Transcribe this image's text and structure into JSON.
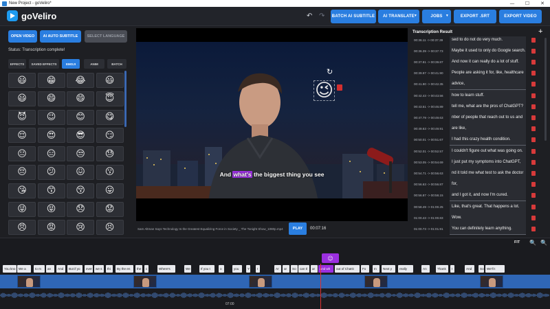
{
  "window": {
    "title": "New Project - goVeliro*",
    "minimize": "—",
    "maximize": "☐",
    "close": "✕"
  },
  "header": {
    "logo_text": "goVeliro",
    "undo_icon": "↶",
    "redo_icon": "↷",
    "buttons": {
      "batch_ai_subtitle": "BATCH AI SUBTITLE",
      "ai_translate": "AI TRANSLATE",
      "jobs": "JOBS",
      "export_srt": "EXPORT .SRT",
      "export_video": "EXPORT VIDEO"
    },
    "accent_color": "#2a7ee0"
  },
  "left_panel": {
    "open_video": "OPEN VIDEO",
    "ai_auto_subtitle": "AI AUTO SUBTITLE",
    "select_language": "SELECT LANGUAGE",
    "status": "Status: Transcription complete!",
    "tabs": [
      "EFFECTS",
      "SAVED EFFECTS",
      "EMOJI",
      "ANIM",
      "BATCH"
    ],
    "active_tab": "EMOJI",
    "emojis": [
      "😃",
      "😁",
      "😂",
      "😃",
      "😃",
      "😄",
      "😄",
      "😇",
      "😈",
      "😉",
      "😊",
      "😋",
      "😌",
      "😍",
      "😎",
      "😏",
      "😐",
      "😑",
      "😒",
      "😓",
      "😔",
      "😕",
      "😖",
      "😗",
      "😘",
      "😙",
      "😚",
      "😛",
      "😜",
      "😝",
      "😞",
      "😟",
      "😠",
      "😡",
      "😢",
      "😣"
    ]
  },
  "video": {
    "subtitle_before": "And ",
    "subtitle_highlight": "what's",
    "subtitle_after": " the biggest thing you see",
    "overlay_emoji": "😉",
    "rotate_icon": "↻",
    "file_name": "Sam Altman Says Technology Is the Greatest Equalizing Force in Society _ The Tonight Show_1080p.mp4",
    "play_label": "PLAY",
    "timecode": "00:07:16"
  },
  "transcription": {
    "title": "Transcription Result",
    "add_icon": "+",
    "rows": [
      {
        "tc": "00:36.11 -> 00:37.39",
        "text": "sed to do not do very much."
      },
      {
        "tc": "00:36.39 -> 00:37.73",
        "text": "Maybe it used to only do Google search."
      },
      {
        "tc": "00:37.81 -> 00:39.87",
        "text": "And now it can really do a lot of stuff."
      },
      {
        "tc": "00:39.97 -> 00:41.90",
        "text": "People are asking it for, like, healthcare"
      },
      {
        "tc": "00:41.90 -> 00:42.35",
        "text": "advice,"
      },
      {
        "tc": "00:42.43 -> 00:43.56",
        "text": "how to learn stuff."
      },
      {
        "tc": "00:43.51 -> 00:46.89",
        "text": "tell me, what are the pros of ChatGPT?"
      },
      {
        "tc": "00:47.79 -> 00:49.63",
        "text": "nber of people that reach out to us and"
      },
      {
        "tc": "00:49.63 -> 00:49.91",
        "text": "are like,"
      },
      {
        "tc": "00:50.01 -> 00:51.67",
        "text": "I had this crazy health condition."
      },
      {
        "tc": "00:52.01 -> 00:52.57",
        "text": "I couldn't figure out what was going on."
      },
      {
        "tc": "00:53.05 -> 00:54.69",
        "text": "I just put my symptoms into ChatGPT,"
      },
      {
        "tc": "00:54.71 -> 00:56.63",
        "text": "nd it told me what test to ask the doctor"
      },
      {
        "tc": "00:56.63 -> 00:56.87",
        "text": "for,"
      },
      {
        "tc": "00:56.87 -> 00:58.15",
        "text": "and I got it, and now I'm cured."
      },
      {
        "tc": "00:58.49 -> 01:00.25",
        "text": "Like, that's great. That happens a lot."
      },
      {
        "tc": "01:00.43 -> 01:00.83",
        "text": "Wow."
      },
      {
        "tc": "01:00.73 -> 01:01.91",
        "text": "You can definitely learn anything."
      }
    ]
  },
  "timeline": {
    "fit_label": "FIT",
    "zoom_out_icon": "🔍",
    "zoom_in_icon": "🔍",
    "emoji_marker": "😉",
    "ruler_label": "07:00",
    "words": [
      "You kno",
      "We a",
      "to m",
      "an",
      "And",
      "But if yo",
      "ever",
      "we s",
      "thi",
      "By the en",
      "the",
      "c",
      "Where's",
      "We",
      "If you t",
      "o",
      "you",
      "Y",
      "I",
      "Ar",
      "ar",
      "So",
      "can tl",
      "ar",
      "And wh",
      "out of ChatG",
      "Fo",
      "In",
      "Next y",
      "really",
      "An",
      "Thank",
      "I",
      "And",
      "So",
      "We'll t"
    ]
  }
}
